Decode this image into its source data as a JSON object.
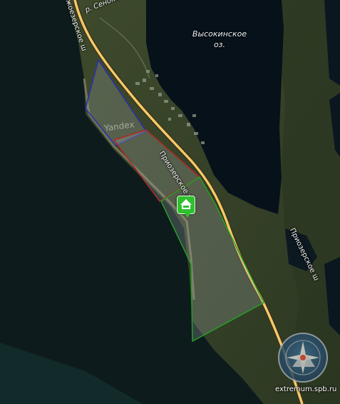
{
  "map": {
    "lake_name": "Высокинское",
    "lake_suffix": "оз.",
    "river_name": "р. Сенокосная",
    "road_name_main": "Приозерское ш",
    "road_name_north": "жоезерское ш",
    "road_name_south": "Приозерское ш",
    "watermark": "Yandex",
    "credit": "extremum.spb.ru"
  },
  "areas": [
    {
      "name": "blue-zone",
      "color": "#2b2fb0"
    },
    {
      "name": "red-zone",
      "color": "#b02828"
    },
    {
      "name": "green-zone",
      "color": "#24a024"
    }
  ],
  "marker": {
    "icon": "campsite-icon",
    "color": "#2fc02f"
  },
  "logo": {
    "icon": "emblem-icon"
  }
}
